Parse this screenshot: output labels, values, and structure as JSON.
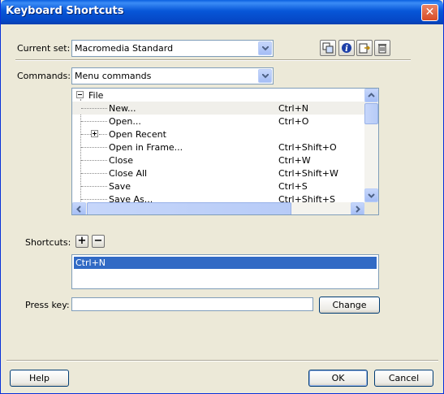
{
  "window": {
    "title": "Keyboard Shortcuts"
  },
  "current_set": {
    "label": "Current set:",
    "value": "Macromedia Standard"
  },
  "toolbar_icons": [
    "duplicate-set-icon",
    "rename-set-icon",
    "export-set-icon",
    "delete-set-icon"
  ],
  "commands": {
    "label": "Commands:",
    "value": "Menu commands"
  },
  "tree": {
    "root": "File",
    "rows": [
      {
        "name": "New...",
        "key": "Ctrl+N",
        "selected": true
      },
      {
        "name": "Open...",
        "key": "Ctrl+O"
      },
      {
        "name": "Open Recent",
        "key": "",
        "expandable": true
      },
      {
        "name": "Open in Frame...",
        "key": "Ctrl+Shift+O"
      },
      {
        "name": "Close",
        "key": "Ctrl+W"
      },
      {
        "name": "Close All",
        "key": "Ctrl+Shift+W"
      },
      {
        "name": "Save",
        "key": "Ctrl+S"
      },
      {
        "name": "Save As...",
        "key": "Ctrl+Shift+S"
      }
    ]
  },
  "shortcuts": {
    "label": "Shortcuts:",
    "add_symbol": "+",
    "remove_symbol": "−",
    "items": [
      "Ctrl+N"
    ]
  },
  "press_key": {
    "label": "Press key:",
    "value": "",
    "change_label": "Change"
  },
  "footer": {
    "help_label": "Help",
    "ok_label": "OK",
    "cancel_label": "Cancel"
  },
  "colors": {
    "titlebar": "#0756d8",
    "dialog_bg": "#ece9d8",
    "selection": "#316ac5",
    "close": "#d74b26"
  }
}
